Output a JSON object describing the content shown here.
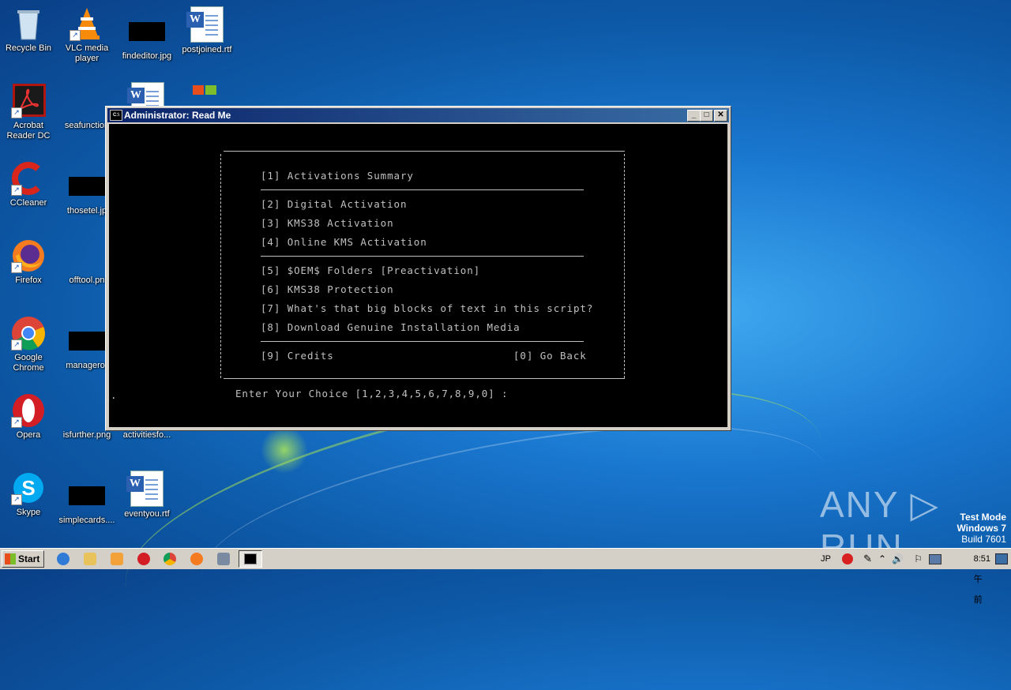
{
  "desktop": {
    "icons": [
      {
        "label": "Recycle Bin",
        "icon": "recycle-bin-icon"
      },
      {
        "label": "VLC media player",
        "icon": "vlc-icon"
      },
      {
        "label": "findeditor.jpg",
        "icon": "image-file-icon"
      },
      {
        "label": "postjoined.rtf",
        "icon": "word-document-icon"
      },
      {
        "label": "Acrobat Reader DC",
        "icon": "acrobat-icon"
      },
      {
        "label": "seafunction",
        "icon": "word-document-icon"
      },
      {
        "label": "CCleaner",
        "icon": "ccleaner-icon"
      },
      {
        "label": "thosetel.jp",
        "icon": "image-file-icon"
      },
      {
        "label": "Firefox",
        "icon": "firefox-icon"
      },
      {
        "label": "offtool.pn",
        "icon": "image-file-icon"
      },
      {
        "label": "Google Chrome",
        "icon": "chrome-icon"
      },
      {
        "label": "manageror",
        "icon": "image-file-icon"
      },
      {
        "label": "Opera",
        "icon": "opera-icon"
      },
      {
        "label": "isfurther.png",
        "icon": "image-file-icon"
      },
      {
        "label": "activitiesfo...",
        "icon": "image-file-icon"
      },
      {
        "label": "Skype",
        "icon": "skype-icon"
      },
      {
        "label": "simplecards....",
        "icon": "image-file-icon"
      },
      {
        "label": "eventyou.rtf",
        "icon": "word-document-icon"
      }
    ]
  },
  "window": {
    "title": "Administrator:  Read Me",
    "minimize": "_",
    "maximize": "□",
    "close": "✕",
    "menu": [
      {
        "text": "[1] Activations Summary"
      },
      {
        "text": "[2] Digital Activation"
      },
      {
        "text": "[3] KMS38 Activation"
      },
      {
        "text": "[4] Online KMS Activation"
      },
      {
        "text": "[5] $OEM$ Folders [Preactivation]"
      },
      {
        "text": "[6] KMS38 Protection"
      },
      {
        "text": "[7] What's that big blocks of text in this script?"
      },
      {
        "text": "[8] Download Genuine Installation Media"
      },
      {
        "text": "[9] Credits"
      },
      {
        "text": "[0] Go Back"
      }
    ],
    "prompt": "Enter Your Choice [1,2,3,4,5,6,7,8,9,0] :",
    "cursor": "."
  },
  "watermark": {
    "brand": "ANY ▷ RUN",
    "test_mode": "Test Mode",
    "os": "Windows 7",
    "build": "Build 7601"
  },
  "taskbar": {
    "start_label": "Start",
    "language": "JP",
    "clock": "8:51 午前"
  }
}
